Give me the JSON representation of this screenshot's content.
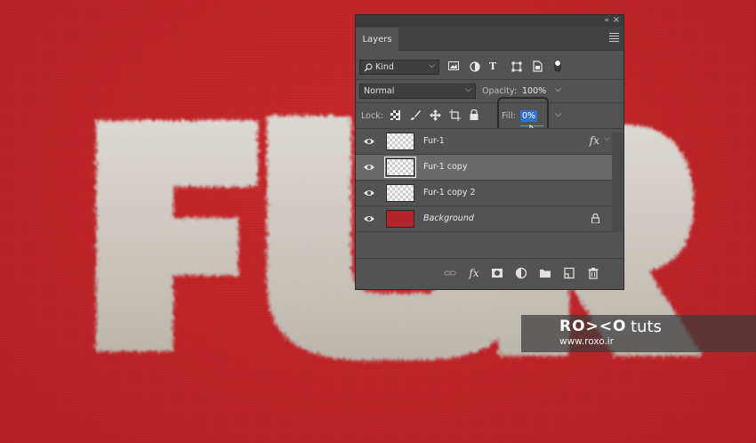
{
  "canvas": {
    "text": "FUR",
    "background_color": "#c2262a",
    "fur_color": "#d4cfc8"
  },
  "panel": {
    "tab_label": "Layers",
    "collapse_glyph": "«",
    "close_glyph": "×",
    "filter": {
      "kind_label": "Kind",
      "icons": [
        "image-filter-icon",
        "adjustment-filter-icon",
        "type-filter-icon",
        "shape-filter-icon",
        "smart-object-filter-icon",
        "filter-toggle-icon"
      ]
    },
    "blend_mode": "Normal",
    "opacity_label": "Opacity:",
    "opacity_value": "100%",
    "lock_label": "Lock:",
    "fill_label": "Fill:",
    "fill_value": "0%",
    "layers": [
      {
        "name": "Fur-1",
        "visible": true,
        "selected": false,
        "has_fx": true,
        "fx_label": "fx",
        "type": "transparent"
      },
      {
        "name": "Fur-1 copy",
        "visible": true,
        "selected": true,
        "has_fx": false,
        "type": "transparent"
      },
      {
        "name": "Fur-1 copy 2",
        "visible": true,
        "selected": false,
        "has_fx": false,
        "type": "transparent"
      },
      {
        "name": "Background",
        "visible": true,
        "selected": false,
        "locked": true,
        "type": "background"
      }
    ],
    "bottom_fx_label": "fx"
  },
  "watermark": {
    "brand": "RO><O",
    "tuts": "tuts",
    "url": "www.roxo.ir"
  }
}
